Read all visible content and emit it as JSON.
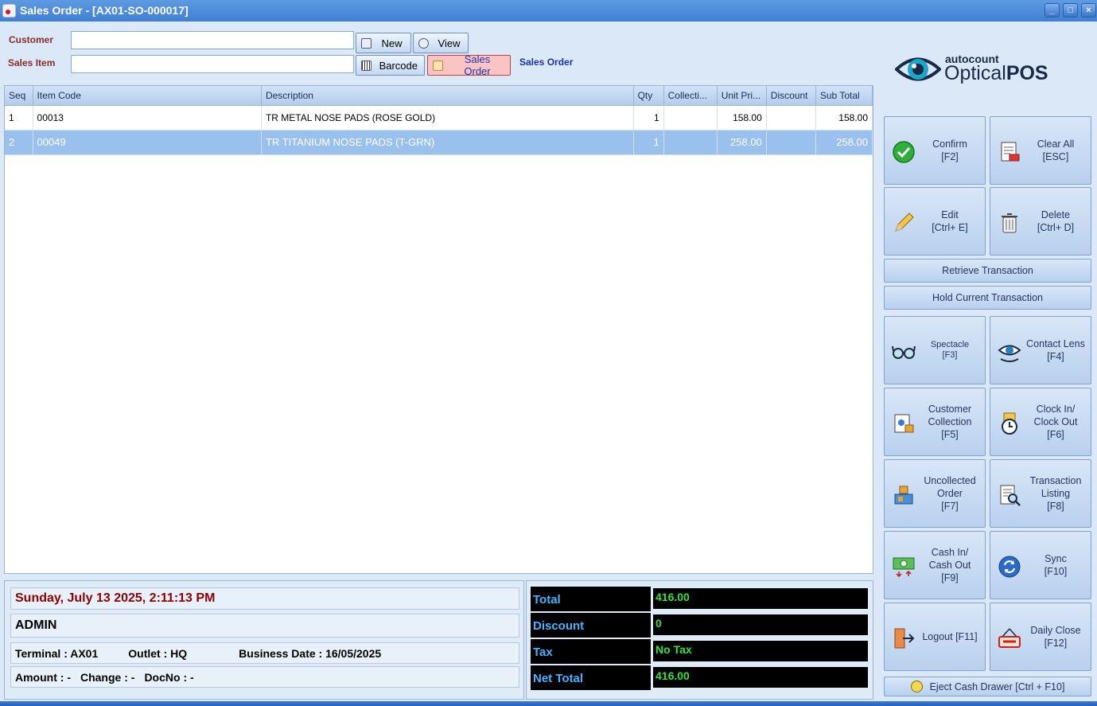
{
  "window": {
    "title": "Sales Order - [AX01-SO-000017]",
    "min": "_",
    "max": "□",
    "close": "×"
  },
  "form": {
    "customer_label": "Customer",
    "sales_item_label": "Sales Item",
    "customer_value": "",
    "sales_item_value": "",
    "new_label": "New",
    "view_label": "View",
    "barcode_label": "Barcode",
    "sales_order_label": "Sales Order",
    "sales_order_link": "Sales Order"
  },
  "grid": {
    "columns": [
      "Seq",
      "Item Code",
      "Description",
      "Qty",
      "Collecti...",
      "Unit Pri...",
      "Discount",
      "Sub Total"
    ],
    "rows": [
      {
        "seq": "1",
        "code": "00013",
        "desc": "TR METAL NOSE PADS (ROSE GOLD)",
        "qty": "1",
        "collection": "",
        "price": "158.00",
        "discount": "",
        "subtotal": "158.00"
      },
      {
        "seq": "2",
        "code": "00049",
        "desc": "TR TITANIUM NOSE PADS (T-GRN)",
        "qty": "1",
        "collection": "",
        "price": "258.00",
        "discount": "",
        "subtotal": "258.00"
      }
    ]
  },
  "info": {
    "datetime": "Sunday, July 13 2025, 2:11:13 PM",
    "user": "ADMIN",
    "terminal": "Terminal : AX01",
    "outlet": "Outlet : HQ",
    "business_date": "Business Date : 16/05/2025",
    "amount": "Amount : -",
    "change": "Change : -",
    "docno": "DocNo : -"
  },
  "totals": {
    "total_label": "Total",
    "total_value": "416.00",
    "discount_label": "Discount",
    "discount_value": "0",
    "tax_label": "Tax",
    "tax_value": "No Tax",
    "net_label": "Net Total",
    "net_value": "416.00"
  },
  "logo": {
    "brand_small": "autocount",
    "brand_large_a": "Optical",
    "brand_large_b": "POS"
  },
  "actions": {
    "confirm": "Confirm\n[F2]",
    "clear_all": "Clear All\n[ESC]",
    "edit": "Edit\n[Ctrl+ E]",
    "delete": "Delete\n[Ctrl+ D]",
    "retrieve": "Retrieve Transaction",
    "hold": "Hold Current Transaction",
    "spectacle": "Spectacle\n[F3]",
    "contact_lens": "Contact  Lens\n[F4]",
    "customer_collection": "Customer\nCollection\n[F5]",
    "clock": "Clock In/\nClock Out\n[F6]",
    "uncollected": "Uncollected\nOrder\n[F7]",
    "transaction_listing": "Transaction\nListing\n[F8]",
    "cash": "Cash In/\nCash Out\n[F9]",
    "sync": "Sync\n[F10]",
    "logout": "Logout [F11]",
    "daily_close": "Daily Close\n[F12]",
    "eject": "Eject Cash Drawer [Ctrl + F10]"
  },
  "colors": {
    "accent": "#3f7fd3",
    "selected_row": "#9ac0ee",
    "total_text": "#3ae13a",
    "total_label": "#46b3ff",
    "date_text": "#8b0000"
  }
}
